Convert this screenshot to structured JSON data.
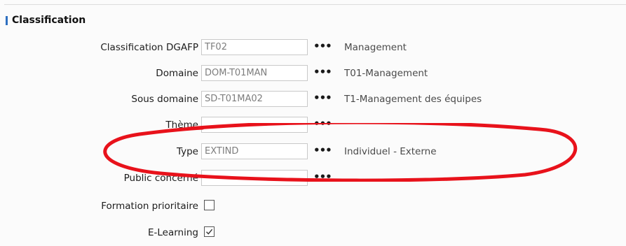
{
  "section": {
    "title": "Classification"
  },
  "fields": {
    "classification_dgafp": {
      "label": "Classification DGAFP",
      "value": "TF02",
      "description": "Management"
    },
    "domaine": {
      "label": "Domaine",
      "value": "DOM-T01MAN",
      "description": "T01-Management"
    },
    "sous_domaine": {
      "label": "Sous domaine",
      "value": "SD-T01MA02",
      "description": "T1-Management des équipes"
    },
    "theme": {
      "label": "Thème",
      "value": "",
      "description": ""
    },
    "type": {
      "label": "Type",
      "value": "EXTIND",
      "description": "Individuel - Externe"
    },
    "public_concerne": {
      "label": "Public concerné",
      "value": "",
      "description": ""
    },
    "formation_prioritaire": {
      "label": "Formation prioritaire",
      "checked": false
    },
    "e_learning": {
      "label": "E-Learning",
      "checked": true
    }
  },
  "lookup_button": {
    "label": "•••"
  },
  "colors": {
    "annotation": "#e8121b",
    "accent": "#2e6fc0"
  },
  "icons": {
    "check": "check-icon"
  }
}
